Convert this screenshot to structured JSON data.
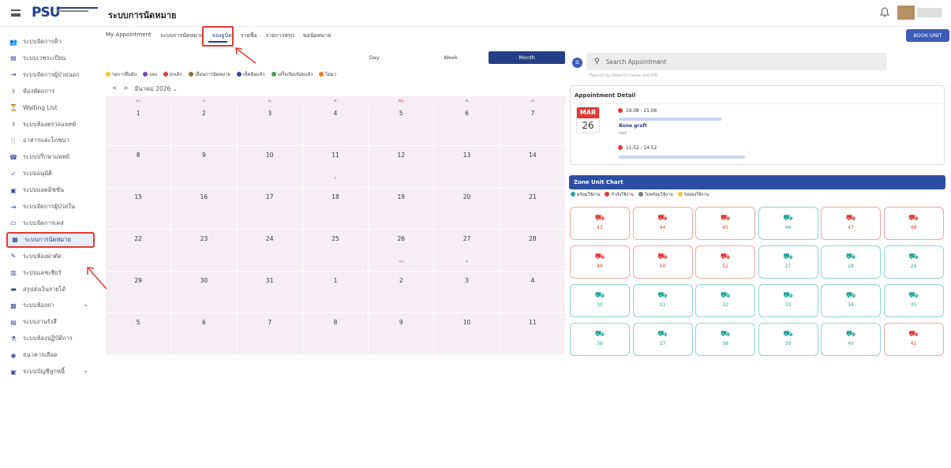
{
  "header": {
    "app_title": "ระบบการนัดหมาย",
    "logo_text": "PSU"
  },
  "sidebar": {
    "items": [
      {
        "label": "ระบบจัดการคิว",
        "icon": "people-icon"
      },
      {
        "label": "ระบบเวชระเบียน",
        "icon": "folder-icon"
      },
      {
        "label": "ระบบจัดการผู้ป่วยนอก",
        "icon": "login-icon"
      },
      {
        "label": "ห้องหัตถการ",
        "icon": "procedure-icon"
      },
      {
        "label": "Waiting List",
        "icon": "waiting-icon"
      },
      {
        "label": "ระบบห้องตรวจแพทย์",
        "icon": "stethoscope-icon"
      },
      {
        "label": "อาหารและโภชนา",
        "icon": "food-icon"
      },
      {
        "label": "ระบบปรึกษาแพทย์",
        "icon": "consult-icon"
      },
      {
        "label": "ระบบอนุมัติ",
        "icon": "check-icon"
      },
      {
        "label": "ระบบแอดมิชชั่น",
        "icon": "admission-icon"
      },
      {
        "label": "ระบบจัดการผู้ป่วยใน",
        "icon": "login-icon"
      },
      {
        "label": "ระบบจัดการเคส",
        "icon": "case-icon"
      },
      {
        "label": "ระบบการนัดหมาย",
        "icon": "calendar-icon"
      },
      {
        "label": "ระบบห้องผ่าตัด",
        "icon": "scalpel-icon"
      },
      {
        "label": "ระบบแคชเชียร์",
        "icon": "cashier-icon"
      },
      {
        "label": "สรุปส่งเงินรายได้",
        "icon": "money-icon"
      },
      {
        "label": "ระบบห้องยา",
        "icon": "pharmacy-icon",
        "chevron": "⌄"
      },
      {
        "label": "ระบบงานรังสี",
        "icon": "radiology-icon"
      },
      {
        "label": "ระบบห้องปฏิบัติการ",
        "icon": "lab-icon"
      },
      {
        "label": "ธนาคารเลือด",
        "icon": "blood-icon"
      },
      {
        "label": "ระบบบัญชีลูกหนี้",
        "icon": "account-icon",
        "chevron": "⌄"
      }
    ]
  },
  "tabs": [
    {
      "label": "My Appointment"
    },
    {
      "label": "ระบบการนัดหมาย"
    },
    {
      "label": "จองยูนิต"
    },
    {
      "label": "รายชื่อ"
    },
    {
      "label": "รายการสรุป"
    },
    {
      "label": "ขอนัดหมาย"
    }
  ],
  "book_unit_label": "BOOK UNIT",
  "view_toggle": [
    "Day",
    "Week",
    "Month"
  ],
  "legend": [
    {
      "label": "รอการยืนยัน",
      "color": "#f4c430"
    },
    {
      "label": "จอง",
      "color": "#7b3fc4"
    },
    {
      "label": "ยกเลิก",
      "color": "#e53935"
    },
    {
      "label": "เลื่อนการนัดหมาย",
      "color": "#9c6b30"
    },
    {
      "label": "เช็คอินแล้ว",
      "color": "#2f4ea5"
    },
    {
      "label": "เสร็จเรียบร้อยแล้ว",
      "color": "#43a047"
    },
    {
      "label": "ไม่มา",
      "color": "#ef7c1a"
    }
  ],
  "calendar": {
    "prev": "<",
    "next": ">",
    "month_label": "มีนาคม 2026",
    "dropdown": "⌄",
    "weekdays": [
      "อา.",
      "จ.",
      "อ.",
      "พ.",
      "พฤ.",
      "ศ.",
      "ส."
    ],
    "days": [
      "1",
      "2",
      "3",
      "4",
      "5",
      "6",
      "7",
      "8",
      "9",
      "10",
      "11",
      "12",
      "13",
      "14",
      "15",
      "16",
      "17",
      "18",
      "19",
      "20",
      "21",
      "22",
      "23",
      "24",
      "25",
      "26",
      "27",
      "28",
      "29",
      "30",
      "31",
      "1",
      "2",
      "3",
      "4",
      "5",
      "6",
      "7",
      "8",
      "9",
      "10",
      "11"
    ]
  },
  "search": {
    "placeholder": "Search Appointment",
    "hint": "*Search by Patient's name and HN"
  },
  "appointment_detail": {
    "title": "Appointment Detail",
    "month": "MAR",
    "day": "26",
    "events": [
      {
        "time": "19:08 - 21:08",
        "procedure": "Bone graft",
        "note": "test"
      },
      {
        "time": "11:52 - 14:52"
      }
    ]
  },
  "zone": {
    "title": "Zone Unit Chart",
    "legend": [
      {
        "label": "พร้อมใช้งาน",
        "color": "#26a69a"
      },
      {
        "label": "กำลังใช้งาน",
        "color": "#e53935"
      },
      {
        "label": "ไม่พร้อมใช้งาน",
        "color": "#777777"
      },
      {
        "label": "รอจองใช้งาน",
        "color": "#f4c430"
      }
    ],
    "units": [
      {
        "num": "43",
        "status": "red"
      },
      {
        "num": "44",
        "status": "red"
      },
      {
        "num": "45",
        "status": "red"
      },
      {
        "num": "46",
        "status": "teal"
      },
      {
        "num": "47",
        "status": "red"
      },
      {
        "num": "48",
        "status": "red"
      },
      {
        "num": "49",
        "status": "red"
      },
      {
        "num": "50",
        "status": "red"
      },
      {
        "num": "51",
        "status": "red"
      },
      {
        "num": "27",
        "status": "teal"
      },
      {
        "num": "28",
        "status": "teal"
      },
      {
        "num": "29",
        "status": "teal"
      },
      {
        "num": "30",
        "status": "teal"
      },
      {
        "num": "31",
        "status": "teal"
      },
      {
        "num": "32",
        "status": "teal"
      },
      {
        "num": "33",
        "status": "teal"
      },
      {
        "num": "34",
        "status": "teal"
      },
      {
        "num": "35",
        "status": "teal"
      },
      {
        "num": "36",
        "status": "teal"
      },
      {
        "num": "37",
        "status": "teal"
      },
      {
        "num": "38",
        "status": "teal"
      },
      {
        "num": "39",
        "status": "teal"
      },
      {
        "num": "40",
        "status": "teal"
      },
      {
        "num": "41",
        "status": "red"
      }
    ]
  },
  "colors": {
    "primary": "#243f87",
    "accent_red": "#e53935",
    "teal": "#26a69a"
  }
}
